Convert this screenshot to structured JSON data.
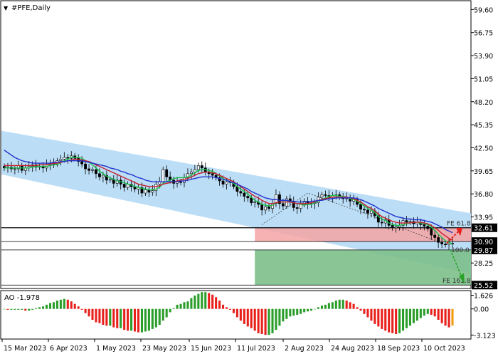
{
  "header": {
    "symbol_label": "#PFE,Daily",
    "marker": "▼"
  },
  "colors": {
    "bg": "#ffffff",
    "frame": "#000000",
    "grid": "#000000",
    "candle": "#000000",
    "channel": "#b7dbf6",
    "ma_fast": "#1bbf4a",
    "ma_mid": "#c8202e",
    "ma_slow": "#2233cc",
    "zone_red": "#f5a5a5",
    "zone_green": "#7cbf8a",
    "ao_up": "#2a9d2a",
    "ao_down": "#e8201c",
    "ao_last": "#f29b0c",
    "arrow_up": "#e8201c",
    "arrow_down": "#2aa22a",
    "price_tag_bg": "#000000"
  },
  "chart_data": [
    {
      "type": "candlestick",
      "title": "#PFE,Daily",
      "ylim": [
        25.1,
        60.6
      ],
      "y_ticks": [
        "59.60",
        "56.75",
        "53.90",
        "51.05",
        "48.20",
        "45.35",
        "42.50",
        "39.65",
        "36.80",
        "33.95",
        "28.25"
      ],
      "x_ticks": [
        "15 Mar 2023",
        "6 Apr 2023",
        "1 May 2023",
        "23 May 2023",
        "15 Jun 2023",
        "11 Jul 2023",
        "2 Aug 2023",
        "24 Aug 2023",
        "18 Sep 2023",
        "10 Oct 2023"
      ],
      "price_tags": [
        "32.61",
        "30.90",
        "29.87",
        "25.52"
      ],
      "levels": [
        {
          "value": 32.61,
          "label": "FE 61.8"
        },
        {
          "value": 30.9,
          "label": ""
        },
        {
          "value": 29.87,
          "label": "100.0"
        },
        {
          "value": 25.52,
          "label": "FE 161.8"
        }
      ],
      "channel": {
        "upper": [
          44.6,
          34.4
        ],
        "lower": [
          39.2,
          27.0
        ]
      },
      "closes": [
        40.0,
        40.1,
        39.9,
        39.9,
        40.3,
        39.7,
        40.0,
        40.2,
        40.4,
        40.1,
        40.2,
        40.0,
        40.4,
        40.6,
        40.5,
        40.9,
        41.1,
        41.3,
        41.2,
        41.5,
        41.2,
        40.8,
        40.5,
        39.9,
        39.7,
        39.8,
        39.3,
        38.9,
        39.1,
        38.5,
        38.6,
        38.1,
        38.5,
        38.0,
        37.6,
        38.0,
        37.7,
        37.4,
        37.6,
        36.9,
        37.3,
        37.0,
        37.2,
        38.0,
        38.3,
        39.8,
        38.9,
        38.5,
        38.1,
        38.3,
        38.2,
        38.8,
        39.3,
        39.5,
        39.8,
        40.3,
        40.0,
        39.5,
        39.3,
        39.1,
        38.8,
        38.4,
        38.0,
        38.3,
        38.2,
        37.7,
        37.1,
        36.9,
        36.5,
        36.3,
        35.7,
        35.8,
        35.5,
        34.8,
        35.2,
        35.0,
        35.6,
        36.7,
        35.6,
        35.3,
        36.2,
        35.8,
        35.1,
        35.0,
        35.5,
        35.9,
        35.5,
        35.6,
        35.7,
        36.4,
        36.7,
        36.6,
        36.4,
        36.6,
        36.7,
        36.4,
        36.2,
        36.3,
        35.9,
        36.1,
        35.5,
        34.9,
        34.8,
        34.4,
        34.7,
        34.1,
        33.3,
        33.2,
        33.6,
        32.9,
        32.6,
        32.7,
        32.9,
        33.5,
        33.3,
        33.4,
        33.1,
        33.3,
        33.0,
        32.8,
        32.5,
        31.7,
        31.4,
        30.8,
        30.6,
        30.5,
        30.7,
        30.6
      ],
      "series": [
        {
          "name": "",
          "kind": "ma_fast",
          "values": [
            40.0,
            40.0,
            40.0,
            40.0,
            40.0,
            40.0,
            40.0,
            40.0,
            40.1,
            40.2,
            40.2,
            40.2,
            40.2,
            40.3,
            40.4,
            40.4,
            40.7,
            40.9,
            41.1,
            41.3,
            41.3,
            41.3,
            41.2,
            40.9,
            40.7,
            40.4,
            40.0,
            39.6,
            39.3,
            39.0,
            38.8,
            38.6,
            38.4,
            38.3,
            38.2,
            38.0,
            37.9,
            37.7,
            37.6,
            37.5,
            37.4,
            37.3,
            37.3,
            37.4,
            37.6,
            38.1,
            38.3,
            38.5,
            38.7,
            38.8,
            38.8,
            38.8,
            38.9,
            39.1,
            39.4,
            39.7,
            39.8,
            39.8,
            39.7,
            39.6,
            39.3,
            39.0,
            38.7,
            38.5,
            38.3,
            38.1,
            37.7,
            37.4,
            37.1,
            36.8,
            36.4,
            36.0,
            35.8,
            35.5,
            35.4,
            35.3,
            35.4,
            35.7,
            35.8,
            35.8,
            35.8,
            35.9,
            35.7,
            35.6,
            35.5,
            35.4,
            35.5,
            35.5,
            35.7,
            35.9,
            36.1,
            36.3,
            36.5,
            36.6,
            36.6,
            36.5,
            36.5,
            36.4,
            36.2,
            36.1,
            35.9,
            35.6,
            35.3,
            35.0,
            34.8,
            34.5,
            34.0,
            33.7,
            33.5,
            33.2,
            33.0,
            32.9,
            32.9,
            33.0,
            33.1,
            33.2,
            33.3,
            33.3,
            33.2,
            33.1,
            33.0,
            32.7,
            32.3,
            31.8,
            31.4,
            31.0,
            30.8,
            30.6
          ]
        },
        {
          "name": "",
          "kind": "ma_mid",
          "values": [
            40.3,
            40.3,
            40.3,
            40.3,
            40.3,
            40.3,
            40.3,
            40.3,
            40.3,
            40.3,
            40.4,
            40.4,
            40.4,
            40.5,
            40.6,
            40.6,
            40.7,
            40.8,
            40.9,
            41.0,
            41.1,
            41.1,
            41.0,
            40.9,
            40.8,
            40.6,
            40.4,
            40.2,
            40.0,
            39.8,
            39.6,
            39.4,
            39.2,
            39.0,
            38.8,
            38.6,
            38.4,
            38.2,
            38.0,
            37.9,
            37.8,
            37.7,
            37.7,
            37.7,
            37.8,
            38.0,
            38.1,
            38.2,
            38.3,
            38.4,
            38.5,
            38.6,
            38.7,
            38.9,
            39.1,
            39.3,
            39.4,
            39.5,
            39.5,
            39.4,
            39.3,
            39.1,
            38.9,
            38.7,
            38.5,
            38.3,
            38.0,
            37.7,
            37.4,
            37.1,
            36.8,
            36.5,
            36.3,
            36.0,
            35.8,
            35.6,
            35.6,
            35.7,
            35.8,
            35.8,
            35.8,
            35.8,
            35.7,
            35.6,
            35.6,
            35.6,
            35.6,
            35.7,
            35.8,
            36.0,
            36.1,
            36.2,
            36.3,
            36.4,
            36.4,
            36.4,
            36.4,
            36.4,
            36.3,
            36.2,
            36.0,
            35.8,
            35.5,
            35.2,
            35.0,
            34.7,
            34.3,
            34.0,
            33.8,
            33.6,
            33.4,
            33.3,
            33.2,
            33.2,
            33.2,
            33.2,
            33.3,
            33.3,
            33.3,
            33.2,
            33.1,
            32.9,
            32.6,
            32.3,
            31.9,
            31.6,
            31.3,
            31.1
          ]
        },
        {
          "name": "",
          "kind": "ma_slow",
          "values": [
            42.2,
            41.9,
            41.6,
            41.3,
            41.1,
            40.9,
            40.8,
            40.7,
            40.6,
            40.6,
            40.6,
            40.6,
            40.6,
            40.6,
            40.7,
            40.7,
            40.8,
            40.8,
            40.9,
            40.9,
            40.9,
            40.9,
            40.9,
            40.8,
            40.7,
            40.6,
            40.5,
            40.4,
            40.3,
            40.2,
            40.0,
            39.9,
            39.8,
            39.6,
            39.5,
            39.3,
            39.2,
            39.0,
            38.8,
            38.7,
            38.5,
            38.4,
            38.3,
            38.3,
            38.3,
            38.3,
            38.3,
            38.3,
            38.3,
            38.3,
            38.4,
            38.4,
            38.5,
            38.6,
            38.7,
            38.8,
            38.9,
            38.9,
            38.9,
            38.9,
            38.8,
            38.7,
            38.6,
            38.5,
            38.3,
            38.2,
            38.0,
            37.8,
            37.6,
            37.4,
            37.1,
            36.9,
            36.7,
            36.5,
            36.3,
            36.2,
            36.1,
            36.1,
            36.0,
            36.0,
            36.0,
            35.9,
            35.9,
            35.8,
            35.8,
            35.8,
            35.8,
            35.9,
            35.9,
            36.0,
            36.0,
            36.1,
            36.2,
            36.2,
            36.3,
            36.3,
            36.3,
            36.3,
            36.3,
            36.3,
            36.2,
            36.1,
            35.9,
            35.7,
            35.5,
            35.3,
            35.0,
            34.8,
            34.6,
            34.4,
            34.2,
            34.0,
            33.9,
            33.8,
            33.7,
            33.7,
            33.6,
            33.6,
            33.6,
            33.5,
            33.4,
            33.3,
            33.1,
            32.9,
            32.7,
            32.4,
            32.2,
            32.0
          ]
        }
      ]
    },
    {
      "type": "bar",
      "title": "AO -1.978",
      "ylim": [
        -3.6,
        2.1
      ],
      "y_ticks": [
        "1.626",
        "0.00",
        "-3.123"
      ],
      "values": [
        0.0,
        -0.1,
        -0.1,
        -0.1,
        -0.1,
        -0.1,
        -0.2,
        -0.2,
        -0.1,
        0.1,
        0.2,
        0.3,
        0.5,
        0.7,
        0.8,
        1.0,
        1.1,
        1.2,
        1.1,
        0.9,
        0.6,
        0.3,
        -0.1,
        -0.5,
        -0.9,
        -1.3,
        -1.6,
        -1.7,
        -1.9,
        -2.0,
        -2.0,
        -2.2,
        -2.3,
        -2.3,
        -2.5,
        -2.6,
        -2.6,
        -2.7,
        -2.8,
        -2.8,
        -2.7,
        -2.6,
        -2.4,
        -2.2,
        -1.9,
        -1.4,
        -1.0,
        -0.4,
        0.1,
        0.5,
        0.6,
        0.8,
        0.9,
        1.3,
        1.6,
        1.8,
        2.0,
        2.0,
        1.9,
        1.7,
        1.4,
        1.0,
        0.5,
        0.2,
        -0.1,
        -0.5,
        -1.0,
        -1.4,
        -1.8,
        -2.1,
        -2.3,
        -2.6,
        -2.9,
        -3.0,
        -3.1,
        -3.1,
        -2.9,
        -2.5,
        -2.0,
        -1.5,
        -1.2,
        -0.9,
        -0.8,
        -0.7,
        -0.6,
        -0.4,
        -0.3,
        -0.2,
        0.0,
        0.2,
        0.4,
        0.5,
        0.7,
        0.8,
        1.0,
        1.1,
        1.1,
        1.0,
        0.8,
        0.6,
        0.2,
        -0.2,
        -0.6,
        -1.0,
        -1.4,
        -1.8,
        -2.1,
        -2.4,
        -2.6,
        -2.8,
        -2.9,
        -3.0,
        -2.9,
        -2.6,
        -2.3,
        -2.0,
        -1.7,
        -1.4,
        -1.1,
        -0.8,
        -0.6,
        -0.7,
        -0.9,
        -1.3,
        -1.7,
        -2.0,
        -2.2,
        -1.978
      ]
    }
  ]
}
